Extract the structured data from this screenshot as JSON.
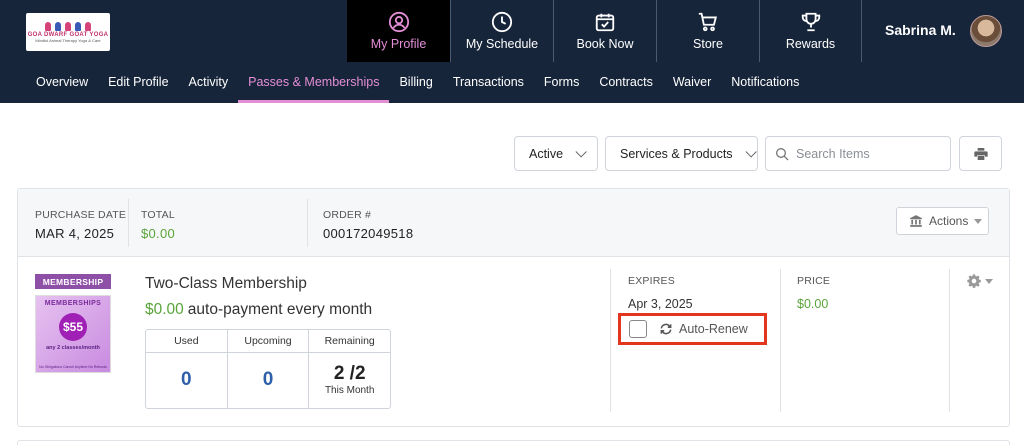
{
  "brand": {
    "name": "GOA DWARF GOAT YOGA",
    "tagline": "Mindful Animal Therapy Yoga & Care"
  },
  "top_nav": [
    {
      "label": "My Profile",
      "icon": "user-circle-icon"
    },
    {
      "label": "My Schedule",
      "icon": "clock-icon"
    },
    {
      "label": "Book Now",
      "icon": "calendar-check-icon"
    },
    {
      "label": "Store",
      "icon": "cart-icon"
    },
    {
      "label": "Rewards",
      "icon": "trophy-icon"
    }
  ],
  "user": {
    "name": "Sabrina M."
  },
  "sub_nav": [
    {
      "label": "Overview"
    },
    {
      "label": "Edit Profile"
    },
    {
      "label": "Activity"
    },
    {
      "label": "Passes & Memberships",
      "active": true
    },
    {
      "label": "Billing"
    },
    {
      "label": "Transactions"
    },
    {
      "label": "Forms"
    },
    {
      "label": "Contracts"
    },
    {
      "label": "Waiver"
    },
    {
      "label": "Notifications"
    }
  ],
  "filters": {
    "status": "Active",
    "category": "Services & Products",
    "search_placeholder": "Search Items"
  },
  "order": {
    "purchase_date_label": "PURCHASE DATE",
    "purchase_date": "MAR 4, 2025",
    "total_label": "TOTAL",
    "total": "$0.00",
    "order_label": "ORDER #",
    "order_number": "000172049518",
    "actions_label": "Actions"
  },
  "item": {
    "badge": "MEMBERSHIP",
    "thumb_title": "MEMBERSHIPS",
    "thumb_price": "$55",
    "thumb_caption": "any 2 classes/month",
    "thumb_footer": "No Obligations Cancel Anytime No Refunds",
    "name": "Two-Class Membership",
    "price": "$0.00",
    "payment_text": "auto-payment every month",
    "stats": {
      "used_label": "Used",
      "used": "0",
      "upcoming_label": "Upcoming",
      "upcoming": "0",
      "remaining_label": "Remaining",
      "remaining": "2 /2",
      "remaining_sub": "This Month"
    },
    "expires_label": "EXPIRES",
    "expires": "Apr 3, 2025",
    "auto_renew_label": "Auto-Renew",
    "auto_renew_checked": false,
    "price_label": "PRICE",
    "price_value": "$0.00"
  },
  "colors": {
    "header": "#17253a",
    "accent": "#e48ed6",
    "green": "#5aa53a",
    "highlight": "#e2361e",
    "badge": "#8e4fa6"
  }
}
